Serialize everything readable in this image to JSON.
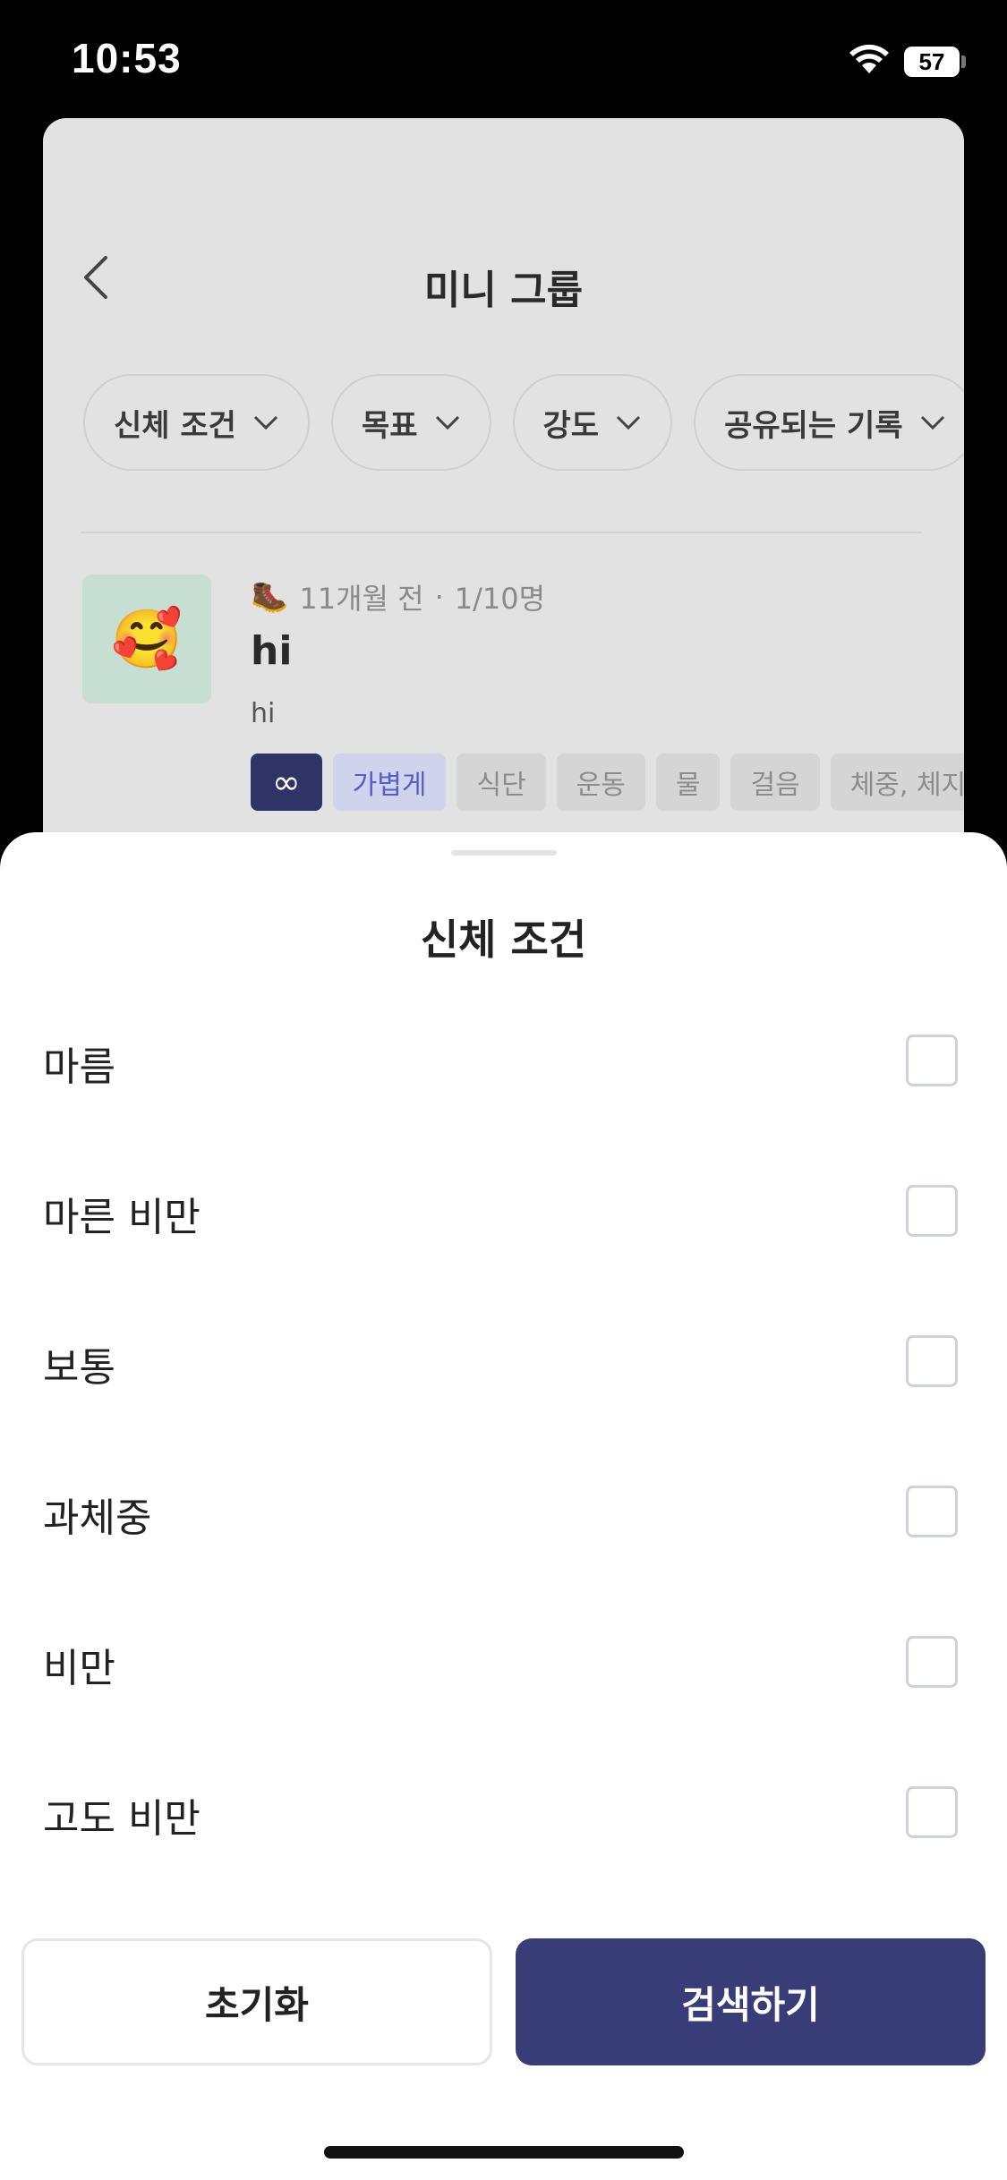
{
  "status_bar": {
    "time": "10:53",
    "battery": "57"
  },
  "page": {
    "title": "미니 그룹",
    "filters": [
      "신체 조건",
      "목표",
      "강도",
      "공유되는 기록"
    ]
  },
  "group_card": {
    "thumbnail_emoji": "🥰",
    "meta_icon": "🥾",
    "time_ago": "11개월 전",
    "separator": "·",
    "members": "1/10명",
    "name": "hi",
    "description": "hi",
    "tags": [
      "∞",
      "가볍게",
      "식단",
      "운동",
      "물",
      "걸음",
      "체중, 체지방"
    ]
  },
  "sheet": {
    "title": "신체 조건",
    "options": [
      "마름",
      "마른 비만",
      "보통",
      "과체중",
      "비만",
      "고도 비만"
    ],
    "reset_label": "초기화",
    "search_label": "검색하기"
  },
  "colors": {
    "primary": "#383d78",
    "tag_blue_bg": "#cfd3ec",
    "tag_blue_text": "#5460c4"
  }
}
